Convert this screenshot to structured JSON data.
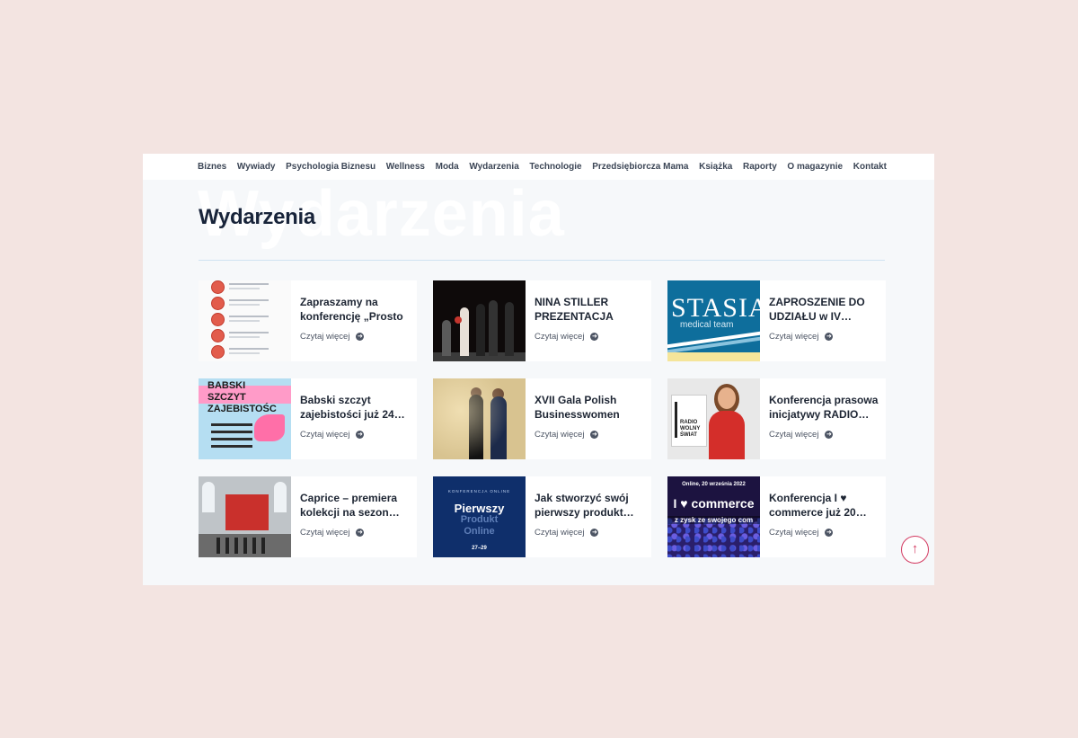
{
  "nav": {
    "items": [
      "Biznes",
      "Wywiady",
      "Psychologia Biznesu",
      "Wellness",
      "Moda",
      "Wydarzenia",
      "Technologie",
      "Przedsiębiorcza Mama",
      "Książka",
      "Raporty",
      "O magazynie",
      "Kontakt"
    ]
  },
  "page": {
    "title": "Wydarzenia",
    "ghost_title": "Wydarzenia"
  },
  "read_more_label": "Czytaj więcej",
  "articles": [
    {
      "title": "Zapraszamy na konferencję „Prosto o…",
      "thumb": "speakers-list"
    },
    {
      "title": "NINA STILLER PREZENTACJA ALBUM…",
      "thumb": "stage-performance"
    },
    {
      "title": "ZAPROSZENIE DO UDZIAŁU w IV…",
      "thumb": "stasiak-medical-team",
      "thumb_text": "STASIAK",
      "thumb_sub": "medical team"
    },
    {
      "title": "Babski szczyt zajebistości już 24…",
      "thumb": "babski-szczyt-poster",
      "thumb_text": "BABSKI SZCZYT ZAJEBISTOŚC"
    },
    {
      "title": "XVII Gala Polish Businesswomen Award…",
      "thumb": "gala-hosts"
    },
    {
      "title": "Konferencja prasowa inicjatywy RADIO…",
      "thumb": "radio-wolny-swiat",
      "thumb_text": "RADIO WOLNY ŚWIAT"
    },
    {
      "title": "Caprice – premiera kolekcji na sezon…",
      "thumb": "fashion-runway"
    },
    {
      "title": "Jak stworzyć swój pierwszy produkt…",
      "thumb": "pierwszy-produkt-online",
      "thumb_small": "KONFERENCJA ONLINE",
      "thumb_text": "Pierwszy",
      "thumb_text2": "Produkt",
      "thumb_text3": "Online",
      "thumb_date": "27–29"
    },
    {
      "title": "Konferencja I ♥ commerce już 20…",
      "thumb": "i-love-commerce",
      "thumb_small": "Online, 20 września 2022",
      "thumb_text": "I ♥ commerce",
      "thumb_text2": "z zysk ze swojego com"
    }
  ],
  "scroll_top_icon": "arrow-up-icon",
  "colors": {
    "background": "#f3e4e1",
    "accent": "#d33a61",
    "title": "#18243a"
  }
}
